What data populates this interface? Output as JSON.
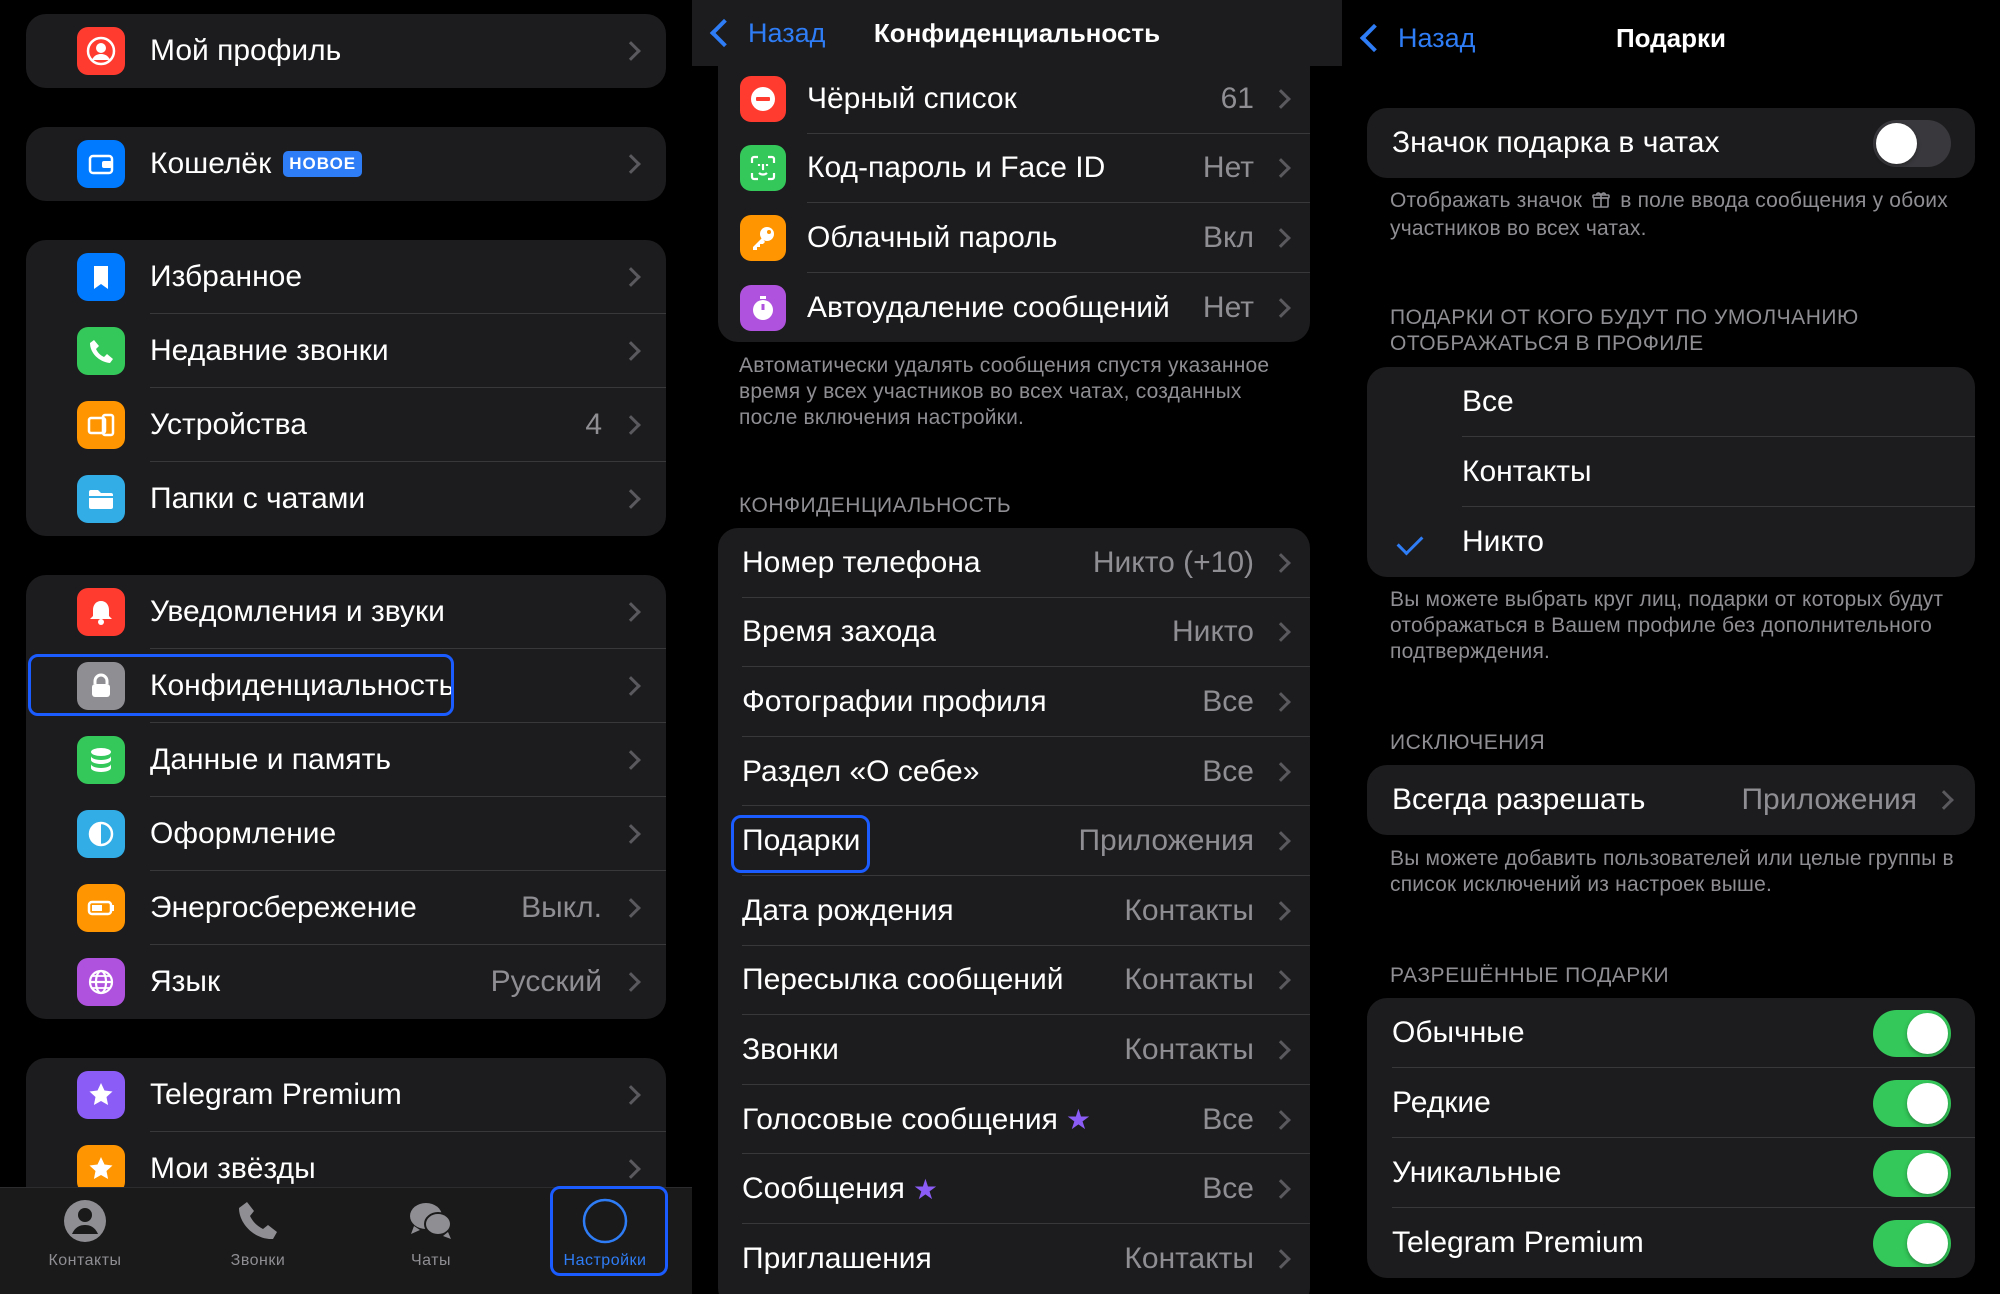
{
  "colors": {
    "accent": "#2f7df6",
    "highlight_box": "#1a5cff",
    "toggle_on": "#34c759",
    "toggle_off": "#39393d",
    "group_bg": "#1c1c1e",
    "secondary_text": "#8e8e93"
  },
  "settings_panel": {
    "groups": [
      {
        "items": [
          {
            "label": "Мой профиль",
            "icon": "profile-icon",
            "icon_color": "#ff3b30"
          }
        ]
      },
      {
        "items": [
          {
            "label": "Кошелёк",
            "badge": "НОВОЕ",
            "icon": "wallet-icon",
            "icon_color": "#007aff"
          }
        ]
      },
      {
        "items": [
          {
            "label": "Избранное",
            "icon": "bookmark-icon",
            "icon_color": "#007aff"
          },
          {
            "label": "Недавние звонки",
            "icon": "phone-icon",
            "icon_color": "#34c759"
          },
          {
            "label": "Устройства",
            "value": "4",
            "icon": "devices-icon",
            "icon_color": "#ff9500"
          },
          {
            "label": "Папки с чатами",
            "icon": "folder-icon",
            "icon_color": "#32ade6"
          }
        ]
      },
      {
        "items": [
          {
            "label": "Уведомления и звуки",
            "icon": "bell-icon",
            "icon_color": "#ff3b30"
          },
          {
            "label": "Конфиденциальность",
            "icon": "lock-icon",
            "icon_color": "#8e8e93",
            "highlighted": true
          },
          {
            "label": "Данные и память",
            "icon": "database-icon",
            "icon_color": "#34c759"
          },
          {
            "label": "Оформление",
            "icon": "appearance-icon",
            "icon_color": "#32ade6"
          },
          {
            "label": "Энергосбережение",
            "value": "Выкл.",
            "icon": "battery-icon",
            "icon_color": "#ff9500"
          },
          {
            "label": "Язык",
            "value": "Русский",
            "icon": "globe-icon",
            "icon_color": "#af52de"
          }
        ]
      },
      {
        "items": [
          {
            "label": "Telegram Premium",
            "icon": "premium-star-icon",
            "icon_color": "#8b5cf6"
          },
          {
            "label": "Мои звёзды",
            "icon": "stars-icon",
            "icon_color": "#ff9500"
          }
        ]
      }
    ],
    "tabbar": [
      {
        "label": "Контакты",
        "icon": "contacts-icon"
      },
      {
        "label": "Звонки",
        "icon": "calls-icon"
      },
      {
        "label": "Чаты",
        "icon": "chats-icon"
      },
      {
        "label": "Настройки",
        "icon": "settings-avatar-icon",
        "active": true
      }
    ]
  },
  "privacy_panel": {
    "back_label": "Назад",
    "title": "Конфиденциальность",
    "security_group": [
      {
        "label": "Чёрный список",
        "value": "61",
        "icon": "blocked-icon",
        "icon_color": "#ff3b30"
      },
      {
        "label": "Код-пароль и Face ID",
        "value": "Нет",
        "icon": "faceid-icon",
        "icon_color": "#34c759"
      },
      {
        "label": "Облачный пароль",
        "value": "Вкл",
        "icon": "key-icon",
        "icon_color": "#ff9500"
      },
      {
        "label": "Автоудаление сообщений",
        "value": "Нет",
        "icon": "timer-icon",
        "icon_color": "#af52de"
      }
    ],
    "security_footer": "Автоматически удалять сообщения спустя указанное время у всех участников во всех чатах, созданных после включения настройки.",
    "privacy_header": "КОНФИДЕНЦИАЛЬНОСТЬ",
    "privacy_group": [
      {
        "label": "Номер телефона",
        "value": "Никто (+10)"
      },
      {
        "label": "Время захода",
        "value": "Никто"
      },
      {
        "label": "Фотографии профиля",
        "value": "Все"
      },
      {
        "label": "Раздел «О себе»",
        "value": "Все"
      },
      {
        "label": "Подарки",
        "value": "Приложения",
        "highlighted": true
      },
      {
        "label": "Дата рождения",
        "value": "Контакты"
      },
      {
        "label": "Пересылка сообщений",
        "value": "Контакты"
      },
      {
        "label": "Звонки",
        "value": "Контакты"
      },
      {
        "label": "Голосовые сообщения",
        "value": "Все",
        "premium_star": true
      },
      {
        "label": "Сообщения",
        "value": "Все",
        "premium_star": true
      },
      {
        "label": "Приглашения",
        "value": "Контакты"
      }
    ]
  },
  "gifts_panel": {
    "back_label": "Назад",
    "title": "Подарки",
    "gift_icon_toggle": {
      "label": "Значок подарка в чатах",
      "on": false
    },
    "gift_icon_footer_pre": "Отображать значок",
    "gift_icon_footer_post": "в поле ввода сообщения у обоих участников во всех чатах.",
    "display_header": "ПОДАРКИ ОТ КОГО БУДУТ ПО УМОЛЧАНИЮ ОТОБРАЖАТЬСЯ В ПРОФИЛЕ",
    "display_options": [
      {
        "label": "Все",
        "selected": false
      },
      {
        "label": "Контакты",
        "selected": false
      },
      {
        "label": "Никто",
        "selected": true
      }
    ],
    "display_footer": "Вы можете выбрать круг лиц, подарки от которых будут отображаться в Вашем профиле без дополнительного подтверждения.",
    "exceptions_header": "ИСКЛЮЧЕНИЯ",
    "exceptions_row": {
      "label": "Всегда разрешать",
      "value": "Приложения"
    },
    "exceptions_footer": "Вы можете добавить пользователей или целые группы в список исключений из настроек выше.",
    "allowed_header": "РАЗРЕШЁННЫЕ ПОДАРКИ",
    "allowed": [
      {
        "label": "Обычные",
        "on": true
      },
      {
        "label": "Редкие",
        "on": true
      },
      {
        "label": "Уникальные",
        "on": true
      },
      {
        "label": "Telegram Premium",
        "on": true
      }
    ]
  }
}
